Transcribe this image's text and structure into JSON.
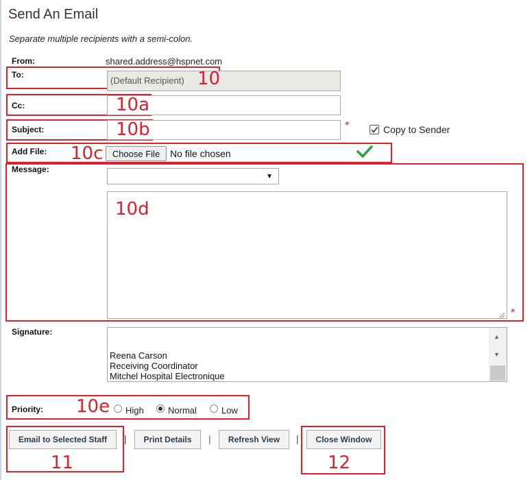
{
  "page": {
    "title": "Send An Email",
    "hint": "Separate multiple recipients with a semi-colon."
  },
  "form": {
    "from_label": "From:",
    "from_value": "shared.address@hspnet.com",
    "to_label": "To:",
    "to_value": "(Default Recipient)",
    "cc_label": "Cc:",
    "cc_value": "",
    "subject_label": "Subject:",
    "subject_value": "",
    "copy_to_sender_label": "Copy to Sender",
    "copy_to_sender_checked": true,
    "add_file_label": "Add File:",
    "choose_file_label": "Choose File",
    "no_file_label": "No file chosen",
    "message_label": "Message:",
    "message_template_selected": "",
    "message_value": "",
    "signature_label": "Signature:",
    "signature_lines": [
      "Reena Carson",
      "Receiving Coordinator",
      "Mitchel Hospital Electronique"
    ],
    "priority_label": "Priority:",
    "priority_options": [
      "High",
      "Normal",
      "Low"
    ],
    "priority_selected": "Normal",
    "required_mark": "*"
  },
  "actions": {
    "email_label": "Email to Selected Staff",
    "print_label": "Print Details",
    "refresh_label": "Refresh View",
    "close_label": "Close Window",
    "separator": "|"
  },
  "annotations": {
    "to": "10",
    "cc": "10a",
    "subject": "10b",
    "add_file": "10c",
    "message": "10d",
    "priority": "10e",
    "email": "11",
    "close": "12"
  },
  "colors": {
    "annotation_red": "#e01f2b",
    "check_green": "#2e9e48"
  }
}
